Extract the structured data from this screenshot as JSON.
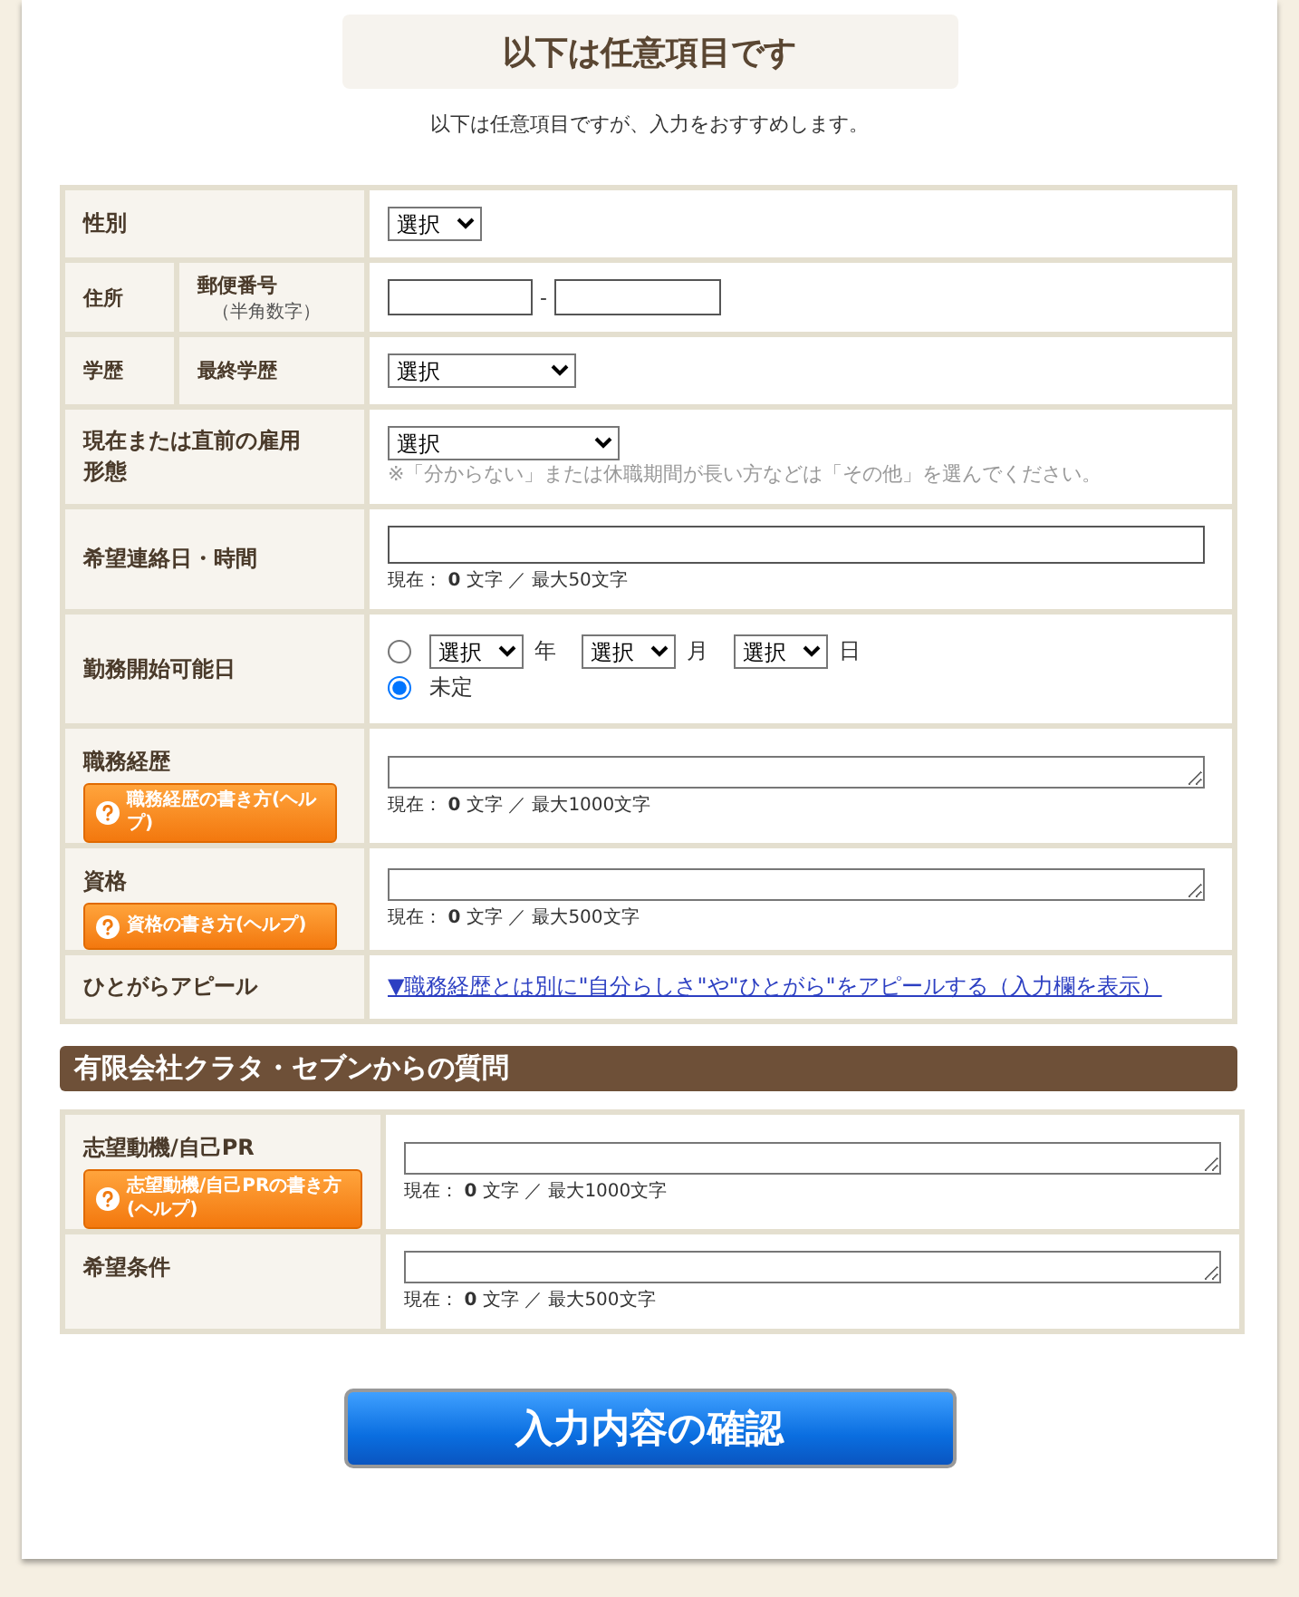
{
  "header": {
    "title": "以下は任意項目です",
    "subtitle": "以下は任意項目ですが、入力をおすすめします。"
  },
  "rows": [
    {
      "kind": "select",
      "label": "性別",
      "select": "選択"
    },
    {
      "kind": "postal",
      "label": "住所",
      "sublabel": "郵便番号",
      "note": "（半角数字）",
      "separator": "-"
    },
    {
      "kind": "select",
      "label": "学歴",
      "sublabel": "最終学歴",
      "select": "選択"
    },
    {
      "kind": "select",
      "label": "現在または直前の雇用形態",
      "select": "選択",
      "hint": "※「分からない」または休職期間が長い方などは「その他」を選んでください。"
    },
    {
      "kind": "text",
      "label": "希望連絡日・時間",
      "counter": "現在： **0** 文字 ／ 最大50文字"
    },
    {
      "kind": "date",
      "label": "勤務開始可能日",
      "options": [
        {
          "kind": "date",
          "selected": false,
          "parts": [
            {
              "select": "選択",
              "unit": "年"
            },
            {
              "select": "選択",
              "unit": "月"
            },
            {
              "select": "選択",
              "unit": "日"
            }
          ]
        },
        {
          "kind": "label",
          "selected": true,
          "label": "未定"
        }
      ]
    },
    {
      "kind": "textarea",
      "label": "職務経歴",
      "help": "職務経歴の書き方(ヘルプ)",
      "counter": "現在： **0** 文字 ／ 最大1000文字"
    },
    {
      "kind": "textarea",
      "label": "資格",
      "help": "資格の書き方(ヘルプ)",
      "counter": "現在： **0** 文字 ／ 最大500文字"
    },
    {
      "kind": "link",
      "label": "ひとがらアピール",
      "link": "▼職務経歴とは別に\"自分らしさ\"や\"ひとがら\"をアピールする（入力欄を表示）"
    }
  ],
  "company_section": {
    "title": "有限会社クラタ・セブンからの質問",
    "rows": [
      {
        "kind": "textarea",
        "label": "志望動機/自己PR",
        "help": "志望動機/自己PRの書き方(ヘルプ)",
        "counter": "現在： **0** 文字 ／ 最大1000文字"
      },
      {
        "kind": "textarea",
        "label": "希望条件",
        "counter": "現在： **0** 文字 ／ 最大500文字"
      }
    ]
  },
  "confirm_button": "入力内容の確認"
}
